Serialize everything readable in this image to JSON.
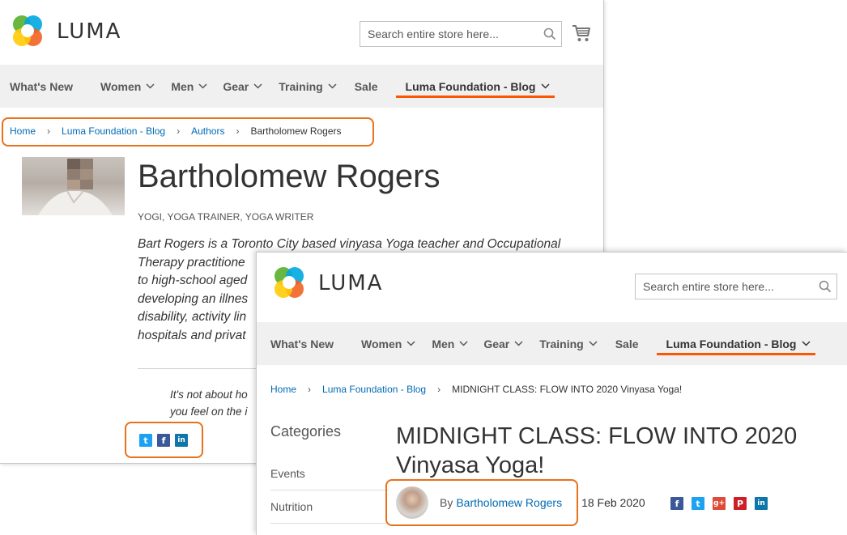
{
  "logo": {
    "text": "LUMA"
  },
  "search": {
    "placeholder": "Search entire store here..."
  },
  "nav": {
    "items": [
      {
        "label": "What's New",
        "dropdown": false
      },
      {
        "label": "Women",
        "dropdown": true
      },
      {
        "label": "Men",
        "dropdown": true
      },
      {
        "label": "Gear",
        "dropdown": true
      },
      {
        "label": "Training",
        "dropdown": true
      },
      {
        "label": "Sale",
        "dropdown": false
      },
      {
        "label": "Luma Foundation - Blog",
        "dropdown": true,
        "active": true
      }
    ]
  },
  "author_page": {
    "breadcrumb": [
      "Home",
      "Luma Foundation - Blog",
      "Authors",
      "Bartholomew Rogers"
    ],
    "name": "Bartholomew Rogers",
    "roles": "YOGI, YOGA TRAINER, YOGA WRITER",
    "bio_lines": [
      "Bart Rogers is a Toronto City based vinyasa Yoga teacher and Occupational",
      "Therapy practitione",
      "to high-school aged",
      "developing an illnes",
      "disability, activity lin",
      "hospitals and privat"
    ],
    "quote_lines": [
      "It's not about ho",
      "you feel on the i"
    ],
    "share": [
      {
        "icon": "twitter-icon",
        "glyph": "t",
        "color": "#1da1f2"
      },
      {
        "icon": "facebook-icon",
        "glyph": "f",
        "color": "#3b5998"
      },
      {
        "icon": "linkedin-icon",
        "glyph": "in",
        "color": "#0e76a8"
      }
    ]
  },
  "post_page": {
    "breadcrumb": [
      "Home",
      "Luma Foundation - Blog",
      "MIDNIGHT CLASS: FLOW INTO 2020 Vinyasa Yoga!"
    ],
    "sidebar": {
      "heading": "Categories",
      "items": [
        "Events",
        "Nutrition"
      ]
    },
    "title": "MIDNIGHT CLASS: FLOW INTO 2020 Vinyasa Yoga!",
    "byline": {
      "prefix": "By",
      "author": "Bartholomew Rogers",
      "date": "18 Feb 2020"
    },
    "share": [
      {
        "icon": "facebook-icon",
        "glyph": "f",
        "color": "#3b5998"
      },
      {
        "icon": "twitter-icon",
        "glyph": "t",
        "color": "#1da1f2"
      },
      {
        "icon": "google-plus-icon",
        "glyph": "g+",
        "color": "#dd4b39"
      },
      {
        "icon": "pinterest-icon",
        "glyph": "P",
        "color": "#cb2027"
      },
      {
        "icon": "linkedin-icon",
        "glyph": "in",
        "color": "#0e76a8"
      }
    ]
  },
  "colors": {
    "accent": "#ff5501",
    "highlight": "#e8711b",
    "link": "#006bb4",
    "nav_bg": "#f0f0f0"
  }
}
